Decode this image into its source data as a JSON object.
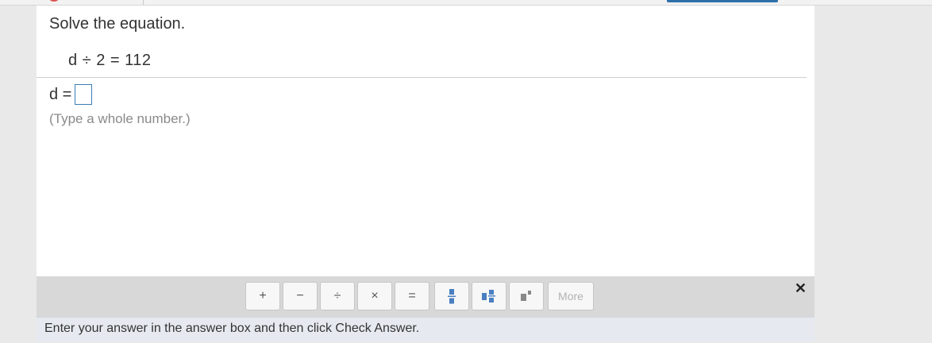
{
  "question": {
    "instruction": "Solve the equation.",
    "equation": "d ÷ 2 = 112",
    "answer_label": "d =",
    "answer_value": "",
    "hint": "(Type a whole number.)"
  },
  "math_toolbar": {
    "buttons": [
      {
        "label": "+",
        "icon": "plus-icon"
      },
      {
        "label": "−",
        "icon": "minus-icon"
      },
      {
        "label": "÷",
        "icon": "divide-icon"
      },
      {
        "label": "×",
        "icon": "times-icon"
      },
      {
        "label": "=",
        "icon": "equals-icon"
      },
      {
        "label": "",
        "icon": "fraction-icon"
      },
      {
        "label": "",
        "icon": "mixed-number-icon"
      },
      {
        "label": "",
        "icon": "exponent-icon"
      },
      {
        "label": "More",
        "icon": ""
      }
    ],
    "close_label": "✕"
  },
  "footer": {
    "instructions": "Enter your answer in the answer box and then click Check Answer."
  },
  "colors": {
    "accent": "#3b7db5",
    "icon_blue": "#4a7fc1"
  }
}
